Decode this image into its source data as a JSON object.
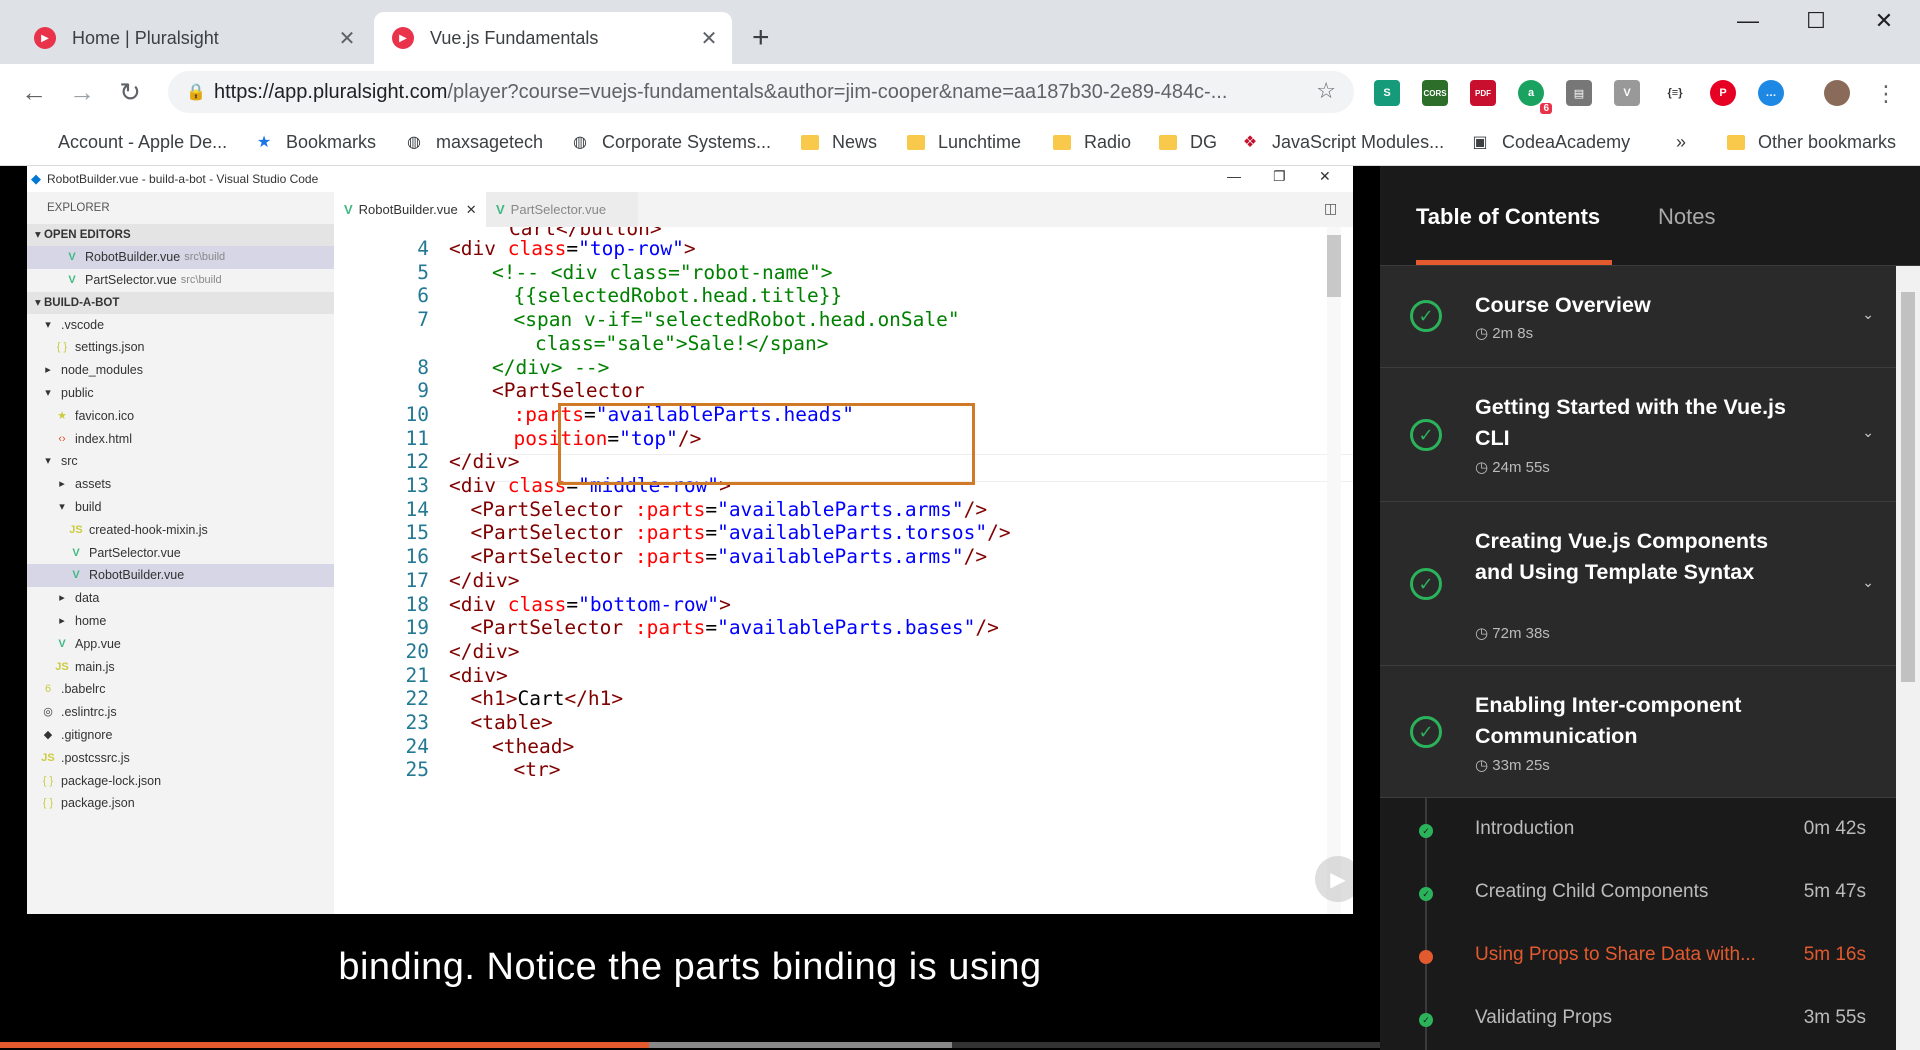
{
  "browser": {
    "tabs": [
      {
        "title": "Home | Pluralsight",
        "active": false
      },
      {
        "title": "Vue.js Fundamentals",
        "active": true
      }
    ],
    "url_host": "https://app.pluralsight.com",
    "url_path": "/player?course=vuejs-fundamentals&author=jim-cooper&name=aa187b30-2e89-484c-...",
    "extensions": [
      "S",
      "CORS",
      "PDF",
      "a",
      "comment",
      "V",
      "{≡}",
      "P",
      "msg"
    ],
    "extension_badge": "6",
    "bookmarks": [
      {
        "label": "Account - Apple De...",
        "icon": "apple-icon"
      },
      {
        "label": "Bookmarks",
        "icon": "star-icon"
      },
      {
        "label": "maxsagetech",
        "icon": "globe-icon"
      },
      {
        "label": "Corporate Systems...",
        "icon": "globe-icon"
      },
      {
        "label": "News",
        "icon": "folder-icon"
      },
      {
        "label": "Lunchtime",
        "icon": "folder-icon"
      },
      {
        "label": "Radio",
        "icon": "folder-icon"
      },
      {
        "label": "DG",
        "icon": "folder-icon"
      },
      {
        "label": "JavaScript Modules...",
        "icon": "site-icon"
      },
      {
        "label": "CodeaAcademy",
        "icon": "site-icon"
      }
    ],
    "more_bookmarks": "»",
    "other_bookmarks": "Other bookmarks"
  },
  "vscode": {
    "window_title": "RobotBuilder.vue - build-a-bot - Visual Studio Code",
    "explorer_header": "EXPLORER",
    "open_editors_label": "OPEN EDITORS",
    "open_editors": [
      {
        "name": "RobotBuilder.vue",
        "path": "src\\build",
        "selected": true
      },
      {
        "name": "PartSelector.vue",
        "path": "src\\build",
        "selected": false
      }
    ],
    "project_label": "BUILD-A-BOT",
    "tree": [
      {
        "name": ".vscode",
        "indent": 1,
        "kind": "folder-open"
      },
      {
        "name": "settings.json",
        "indent": 2,
        "kind": "json"
      },
      {
        "name": "node_modules",
        "indent": 1,
        "kind": "folder"
      },
      {
        "name": "public",
        "indent": 1,
        "kind": "folder-open"
      },
      {
        "name": "favicon.ico",
        "indent": 2,
        "kind": "star"
      },
      {
        "name": "index.html",
        "indent": 2,
        "kind": "html"
      },
      {
        "name": "src",
        "indent": 1,
        "kind": "folder-open"
      },
      {
        "name": "assets",
        "indent": 2,
        "kind": "folder"
      },
      {
        "name": "build",
        "indent": 2,
        "kind": "folder-open"
      },
      {
        "name": "created-hook-mixin.js",
        "indent": 3,
        "kind": "js"
      },
      {
        "name": "PartSelector.vue",
        "indent": 3,
        "kind": "vue"
      },
      {
        "name": "RobotBuilder.vue",
        "indent": 3,
        "kind": "vue",
        "selected": true
      },
      {
        "name": "data",
        "indent": 2,
        "kind": "folder"
      },
      {
        "name": "home",
        "indent": 2,
        "kind": "folder"
      },
      {
        "name": "App.vue",
        "indent": 2,
        "kind": "vue"
      },
      {
        "name": "main.js",
        "indent": 2,
        "kind": "js"
      },
      {
        "name": ".babelrc",
        "indent": 1,
        "kind": "babel"
      },
      {
        "name": ".eslintrc.js",
        "indent": 1,
        "kind": "eslint"
      },
      {
        "name": ".gitignore",
        "indent": 1,
        "kind": "git"
      },
      {
        "name": ".postcssrc.js",
        "indent": 1,
        "kind": "js"
      },
      {
        "name": "package-lock.json",
        "indent": 1,
        "kind": "json"
      },
      {
        "name": "package.json",
        "indent": 1,
        "kind": "json"
      }
    ],
    "editor_tabs": [
      {
        "name": "RobotBuilder.vue",
        "active": true
      },
      {
        "name": "PartSelector.vue",
        "active": false
      }
    ],
    "code_top_partial": "Cart</button>",
    "code_lines": [
      {
        "n": "4",
        "html": "<span class='tg'>&lt;div</span> <span class='at'>class</span>=<span class='st'>\"top-row\"</span><span class='tg'>&gt;</span>",
        "indent": 0
      },
      {
        "n": "5",
        "html": "<span class='cm'>&lt;!-- &lt;div class=\"robot-name\"&gt;</span>",
        "indent": 2
      },
      {
        "n": "6",
        "html": "<span class='cm'>{{selectedRobot.head.title}}</span>",
        "indent": 3
      },
      {
        "n": "7",
        "html": "<span class='cm'>&lt;span v-if=\"selectedRobot.head.onSale\"</span>",
        "indent": 3
      },
      {
        "n": "",
        "html": "<span class='cm'>class=\"sale\"&gt;Sale!&lt;/span&gt;</span>",
        "indent": 4
      },
      {
        "n": "8",
        "html": "<span class='cm'>&lt;/div&gt; --&gt;</span>",
        "indent": 2
      },
      {
        "n": "9",
        "html": "<span class='tg'>&lt;PartSelector</span>",
        "indent": 2
      },
      {
        "n": "10",
        "html": "<span class='at'>:parts</span>=<span class='st'>\"availableParts.heads\"</span>",
        "indent": 3
      },
      {
        "n": "11",
        "html": "<span class='at'>position</span>=<span class='st'>\"top\"</span><span class='tg'>/&gt;</span>",
        "indent": 3
      },
      {
        "n": "12",
        "html": "<span class='tg'>&lt;/div&gt;</span>",
        "indent": 0
      },
      {
        "n": "13",
        "html": "<span class='tg'>&lt;div</span> <span class='at'>class</span>=<span class='st'>\"middle-row\"</span><span class='tg'>&gt;</span>",
        "indent": 0
      },
      {
        "n": "14",
        "html": "<span class='tg'>&lt;PartSelector</span> <span class='at'>:parts</span>=<span class='st'>\"availableParts.arms\"</span><span class='tg'>/&gt;</span>",
        "indent": 1
      },
      {
        "n": "15",
        "html": "<span class='tg'>&lt;PartSelector</span> <span class='at'>:parts</span>=<span class='st'>\"availableParts.torsos\"</span><span class='tg'>/&gt;</span>",
        "indent": 1
      },
      {
        "n": "16",
        "html": "<span class='tg'>&lt;PartSelector</span> <span class='at'>:parts</span>=<span class='st'>\"availableParts.arms\"</span><span class='tg'>/&gt;</span>",
        "indent": 1
      },
      {
        "n": "17",
        "html": "<span class='tg'>&lt;/div&gt;</span>",
        "indent": 0
      },
      {
        "n": "18",
        "html": "<span class='tg'>&lt;div</span> <span class='at'>class</span>=<span class='st'>\"bottom-row\"</span><span class='tg'>&gt;</span>",
        "indent": 0
      },
      {
        "n": "19",
        "html": "<span class='tg'>&lt;PartSelector</span> <span class='at'>:parts</span>=<span class='st'>\"availableParts.bases\"</span><span class='tg'>/&gt;</span>",
        "indent": 1
      },
      {
        "n": "20",
        "html": "<span class='tg'>&lt;/div&gt;</span>",
        "indent": 0
      },
      {
        "n": "21",
        "html": "<span class='tg'>&lt;div&gt;</span>",
        "indent": 0
      },
      {
        "n": "22",
        "html": "<span class='tg'>&lt;h1&gt;</span>Cart<span class='tg'>&lt;/h1&gt;</span>",
        "indent": 1
      },
      {
        "n": "23",
        "html": "<span class='tg'>&lt;table&gt;</span>",
        "indent": 1
      },
      {
        "n": "24",
        "html": "<span class='tg'>&lt;thead&gt;</span>",
        "indent": 2
      },
      {
        "n": "25",
        "html": "<span class='tg'>&lt;tr&gt;</span>",
        "indent": 3
      }
    ]
  },
  "video": {
    "caption": "binding. Notice the parts binding is using",
    "played_fraction": 0.47,
    "buffered_fraction": 0.69
  },
  "toc": {
    "tab_contents": "Table of Contents",
    "tab_notes": "Notes",
    "modules": [
      {
        "title": "Course Overview",
        "duration": "2m 8s"
      },
      {
        "title": "Getting Started with the Vue.js CLI",
        "duration": "24m 55s"
      },
      {
        "title": "Creating Vue.js Components and Using Template Syntax",
        "duration": "72m 38s"
      },
      {
        "title": "Enabling Inter-component Communication",
        "duration": "33m 25s"
      }
    ],
    "clips": [
      {
        "name": "Introduction",
        "duration": "0m 42s",
        "current": false
      },
      {
        "name": "Creating Child Components",
        "duration": "5m 47s",
        "current": false
      },
      {
        "name": "Using Props to Share Data with...",
        "duration": "5m 16s",
        "current": true
      },
      {
        "name": "Validating Props",
        "duration": "3m 55s",
        "current": false
      }
    ]
  },
  "colors": {
    "accent": "#e35a2e",
    "complete": "#2bb35b",
    "highlight_box": "#d07a27"
  }
}
